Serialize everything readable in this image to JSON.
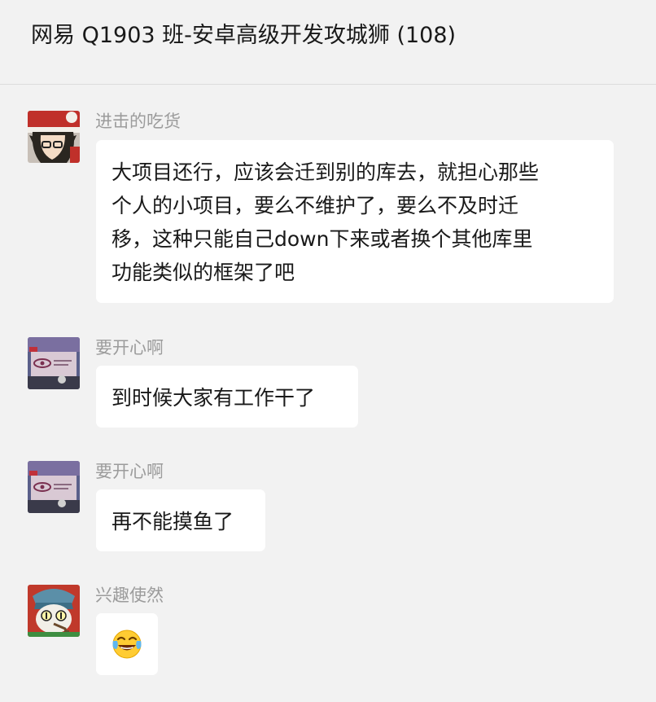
{
  "header": {
    "title": "网易 Q1903 班-安卓高级开发攻城狮 (108)"
  },
  "messages": [
    {
      "sender": "进击的吃货",
      "avatar": "anime-boy-santa-hat-avatar",
      "lines": [
        "大项目还行，应该会迁到别的库去，就担心那些",
        "个人的小项目，要么不维护了，要么不及时迁",
        "移，这种只能自己down下来或者换个其他库里",
        "功能类似的框架了吧"
      ]
    },
    {
      "sender": "要开心啊",
      "avatar": "eye-poster-avatar",
      "lines": [
        "到时候大家有工作干了"
      ]
    },
    {
      "sender": "要开心啊",
      "avatar": "eye-poster-avatar",
      "lines": [
        "再不能摸鱼了"
      ]
    },
    {
      "sender": "兴趣使然",
      "avatar": "cat-with-hat-pipe-avatar",
      "emoji": "tears-of-joy-emoji"
    }
  ],
  "colors": {
    "background": "#f2f2f2",
    "bubble": "#ffffff",
    "sender_name": "#9c9c9c",
    "text": "#191919"
  }
}
